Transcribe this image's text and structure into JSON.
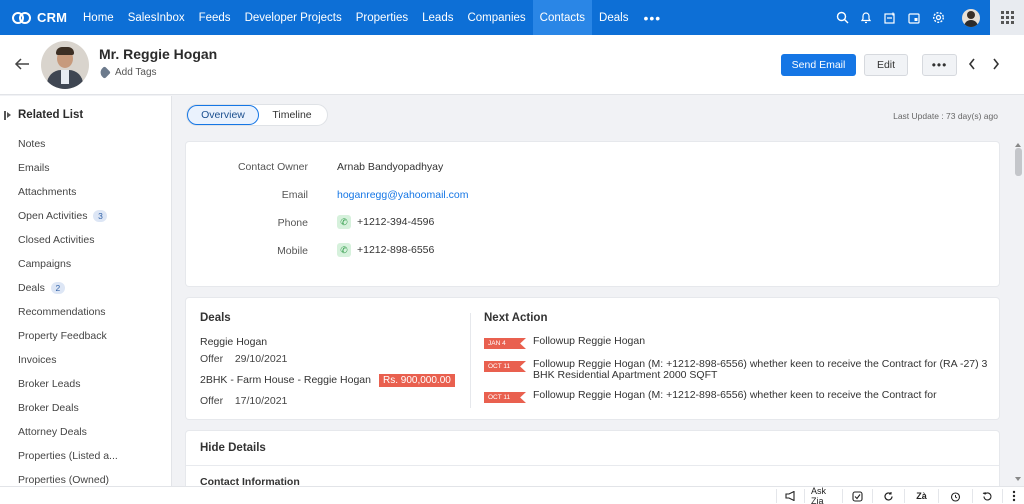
{
  "app": {
    "name": "CRM"
  },
  "nav": {
    "items": [
      "Home",
      "SalesInbox",
      "Feeds",
      "Developer Projects",
      "Properties",
      "Leads",
      "Companies",
      "Contacts",
      "Deals"
    ],
    "active": "Contacts",
    "more": "•••",
    "icons": [
      "search-icon",
      "bell-icon",
      "add-record-icon",
      "calendar-icon",
      "settings-icon",
      "user-avatar",
      "app-grid-icon"
    ]
  },
  "header": {
    "name": "Mr. Reggie Hogan",
    "add_tags": "Add Tags",
    "send_email": "Send Email",
    "edit": "Edit",
    "more": "•••",
    "prev": "‹",
    "next": "›"
  },
  "sidebar": {
    "title": "Related List",
    "items": [
      {
        "label": "Notes"
      },
      {
        "label": "Emails"
      },
      {
        "label": "Attachments"
      },
      {
        "label": "Open Activities",
        "count": "3"
      },
      {
        "label": "Closed Activities"
      },
      {
        "label": "Campaigns"
      },
      {
        "label": "Deals",
        "count": "2"
      },
      {
        "label": "Recommendations"
      },
      {
        "label": "Property Feedback"
      },
      {
        "label": "Invoices"
      },
      {
        "label": "Broker Leads"
      },
      {
        "label": "Broker Deals"
      },
      {
        "label": "Attorney Deals"
      },
      {
        "label": "Properties (Listed a..."
      },
      {
        "label": "Properties (Owned)"
      }
    ]
  },
  "tabs": {
    "overview": "Overview",
    "timeline": "Timeline",
    "active": "Overview"
  },
  "last_update": "Last Update : 73 day(s) ago",
  "contact_info": {
    "owner_label": "Contact Owner",
    "owner_value": "Arnab Bandyopadhyay",
    "email_label": "Email",
    "email_value": "hoganregg@yahoomail.com",
    "phone_label": "Phone",
    "phone_value": "+1212-394-4596",
    "mobile_label": "Mobile",
    "mobile_value": "+1212-898-6556"
  },
  "deals": {
    "title": "Deals",
    "items": [
      {
        "name": "Reggie Hogan",
        "stage": "Offer",
        "date": "29/10/2021"
      },
      {
        "name": "2BHK - Farm House - Reggie Hogan",
        "amount": "Rs. 900,000.00",
        "stage": "Offer",
        "date": "17/10/2021"
      }
    ]
  },
  "next_action": {
    "title": "Next Action",
    "items": [
      {
        "date": "JAN 4",
        "text": "Followup Reggie Hogan"
      },
      {
        "date": "OCT 11",
        "text": "Followup Reggie Hogan (M: +1212-898-6556) whether keen to receive the Contract for (RA -27) 3 BHK Residential Apartment 2000 SQFT"
      },
      {
        "date": "OCT 11",
        "text": "Followup Reggie Hogan (M: +1212-898-6556) whether keen to receive the Contract for"
      }
    ]
  },
  "details": {
    "hide_label": "Hide Details",
    "section_title": "Contact Information"
  },
  "bottom_bar": {
    "ask_zia": "Ask Zia"
  },
  "colors": {
    "nav_bg": "#0d6fd6",
    "primary": "#1576e5",
    "date_flag": "#e9604f"
  }
}
